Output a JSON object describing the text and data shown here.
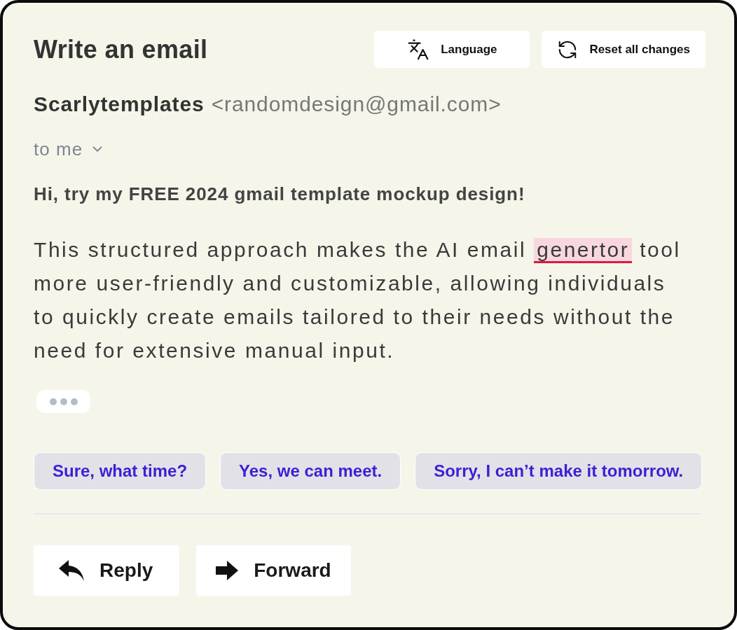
{
  "header": {
    "title": "Write an email",
    "actions": [
      {
        "label": "Language"
      },
      {
        "label": "Reset all changes"
      }
    ]
  },
  "sender": {
    "name": "Scarlytemplates",
    "address": "<randomdesign@gmail.com>"
  },
  "recipient": {
    "label": "to me",
    "expanded": false
  },
  "subject": "Hi, try my FREE 2024 gmail template mockup design!",
  "body": [
    {
      "text": "This structured approach makes the AI email ",
      "misspelled": false
    },
    {
      "text": "genertor",
      "misspelled": true
    },
    {
      "text": " tool more user-friendly and customizable, allowing individuals to quickly create emails tailored to their needs without the need for extensive manual input.",
      "misspelled": false
    }
  ],
  "typing": true,
  "suggested_replies": [
    {
      "label": "Sure, what time?"
    },
    {
      "label": "Yes, we can meet."
    },
    {
      "label": "Sorry, I can’t make it tomorrow."
    }
  ],
  "actions": [
    {
      "label": "Reply"
    },
    {
      "label": "Forward"
    }
  ]
}
